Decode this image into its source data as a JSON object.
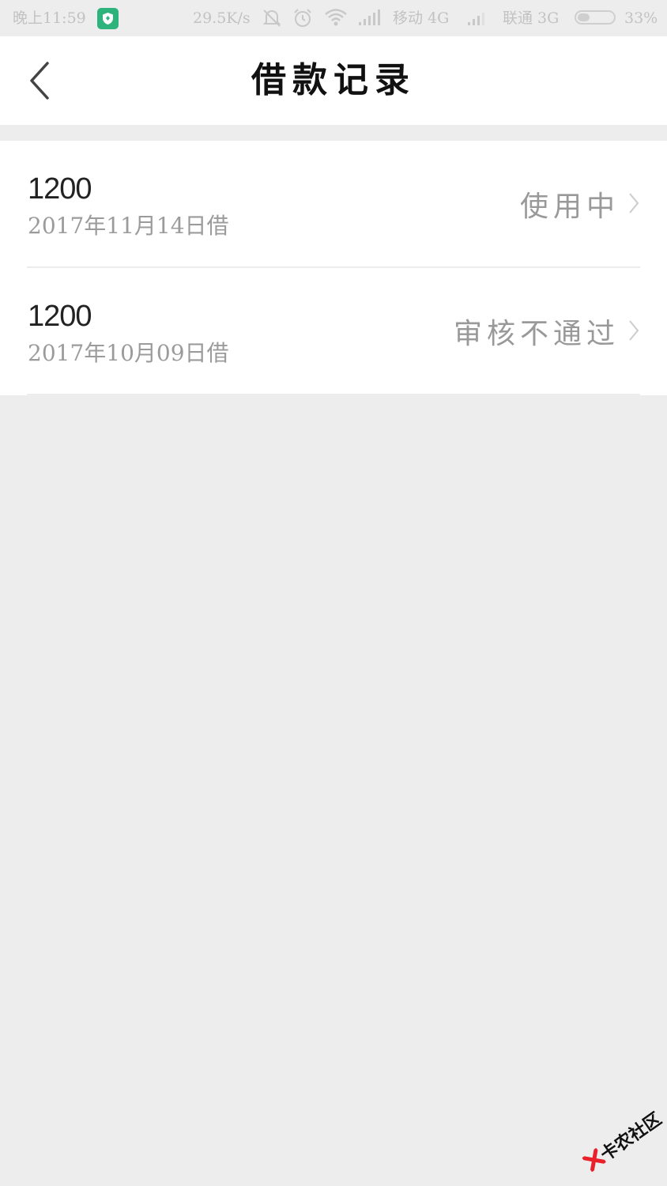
{
  "status_bar": {
    "time": "晚上11:59",
    "net_speed": "29.5K/s",
    "carrier1": "移动 4G",
    "carrier2": "联通 3G",
    "battery": "33%",
    "battery_level": 0.33,
    "shield_color": "#2fb37c"
  },
  "header": {
    "title": "借款记录",
    "back_icon": "chevron-left-icon"
  },
  "records": [
    {
      "amount": "1200",
      "date": "2017年11月14日借",
      "status": "使用中"
    },
    {
      "amount": "1200",
      "date": "2017年10月09日借",
      "status": "审核不通过"
    }
  ],
  "watermark": {
    "text": "卡农社区",
    "logo_color": "#e8212b"
  }
}
